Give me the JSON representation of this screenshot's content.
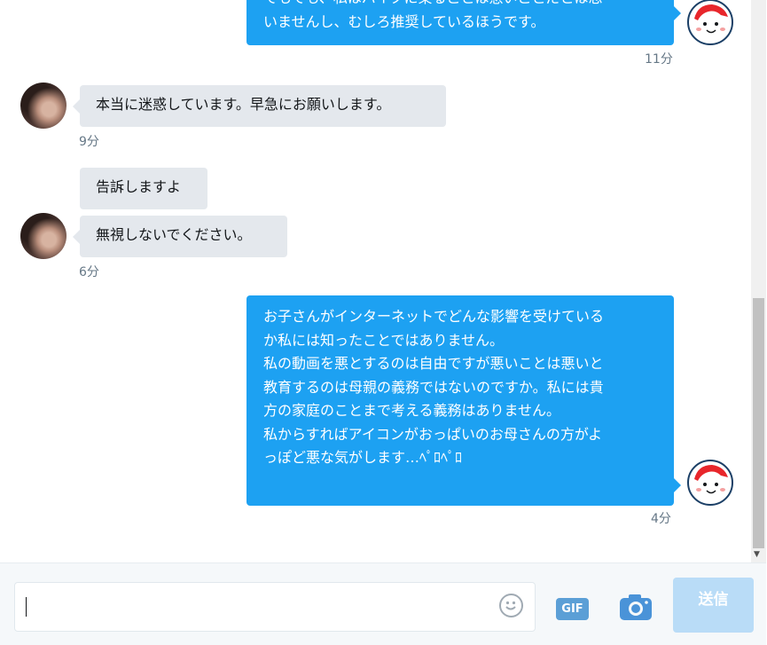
{
  "conversation": {
    "messages": [
      {
        "direction": "outgoing",
        "lines": [
          "でもでも、私はバイクに乗ることは悪いことだとは思",
          "いませんし、むしろ推奨しているほうです。"
        ],
        "time": "11分"
      },
      {
        "direction": "incoming",
        "lines": [
          "本当に迷惑しています。早急にお願いします。"
        ],
        "time": "9分"
      },
      {
        "direction": "incoming",
        "lines": [
          "告訴しますよ"
        ],
        "time": ""
      },
      {
        "direction": "incoming",
        "lines": [
          "無視しないでください。"
        ],
        "time": "6分"
      },
      {
        "direction": "outgoing",
        "lines": [
          "お子さんがインターネットでどんな影響を受けている",
          "か私には知ったことではありません。",
          "私の動画を悪とするのは自由ですが悪いことは悪いと",
          "教育するのは母親の義務ではないのですか。私には貴",
          "方の家庭のことまで考える義務はありません。",
          "",
          "私からすればアイコンがおっぱいのお母さんの方がよ",
          "っぽど悪な気がします…ﾍﾟﾛﾍﾟﾛ"
        ],
        "time": "4分"
      }
    ]
  },
  "composer": {
    "input_value": "",
    "gif_label": "GIF",
    "send_label": "送信",
    "icons": {
      "emoji": "emoji-icon",
      "gif": "gif-icon",
      "camera": "camera-icon"
    }
  },
  "colors": {
    "outgoing_bubble": "#1da1f2",
    "incoming_bubble": "#e4e8ed",
    "send_button_disabled": "#b9dcf7",
    "timestamp": "#657786"
  }
}
